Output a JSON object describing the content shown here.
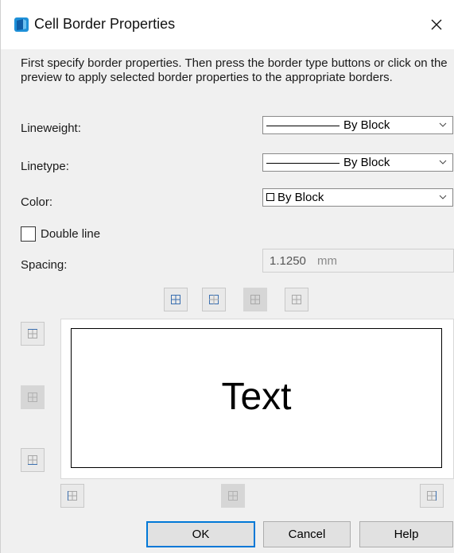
{
  "window": {
    "title": "Cell Border Properties",
    "close_icon": "close-icon"
  },
  "instructions": "First specify border properties. Then press the border type buttons or click on the preview to apply selected border properties to the appropriate borders.",
  "lineweight": {
    "label": "Lineweight:",
    "value": "By Block"
  },
  "linetype": {
    "label": "Linetype:",
    "value": "By Block"
  },
  "color": {
    "label": "Color:",
    "value": "By Block"
  },
  "double_line": {
    "label": "Double line",
    "checked": false
  },
  "spacing": {
    "label": "Spacing:",
    "value": "1.1250",
    "unit": "mm"
  },
  "border_buttons": {
    "top_row": [
      "all-borders",
      "outside-borders",
      "inside-borders",
      "no-borders"
    ],
    "left_column": [
      "top-border",
      "inside-horizontal-border",
      "bottom-border"
    ],
    "bottom_row": [
      "left-border",
      "inside-vertical-border",
      "right-border"
    ]
  },
  "preview": {
    "text": "Text"
  },
  "buttons": {
    "ok": "OK",
    "cancel": "Cancel",
    "help": "Help"
  },
  "colors": {
    "accent": "#0078d7",
    "icon_blue": "#3a6fb0",
    "icon_gray": "#a8a8a8"
  }
}
